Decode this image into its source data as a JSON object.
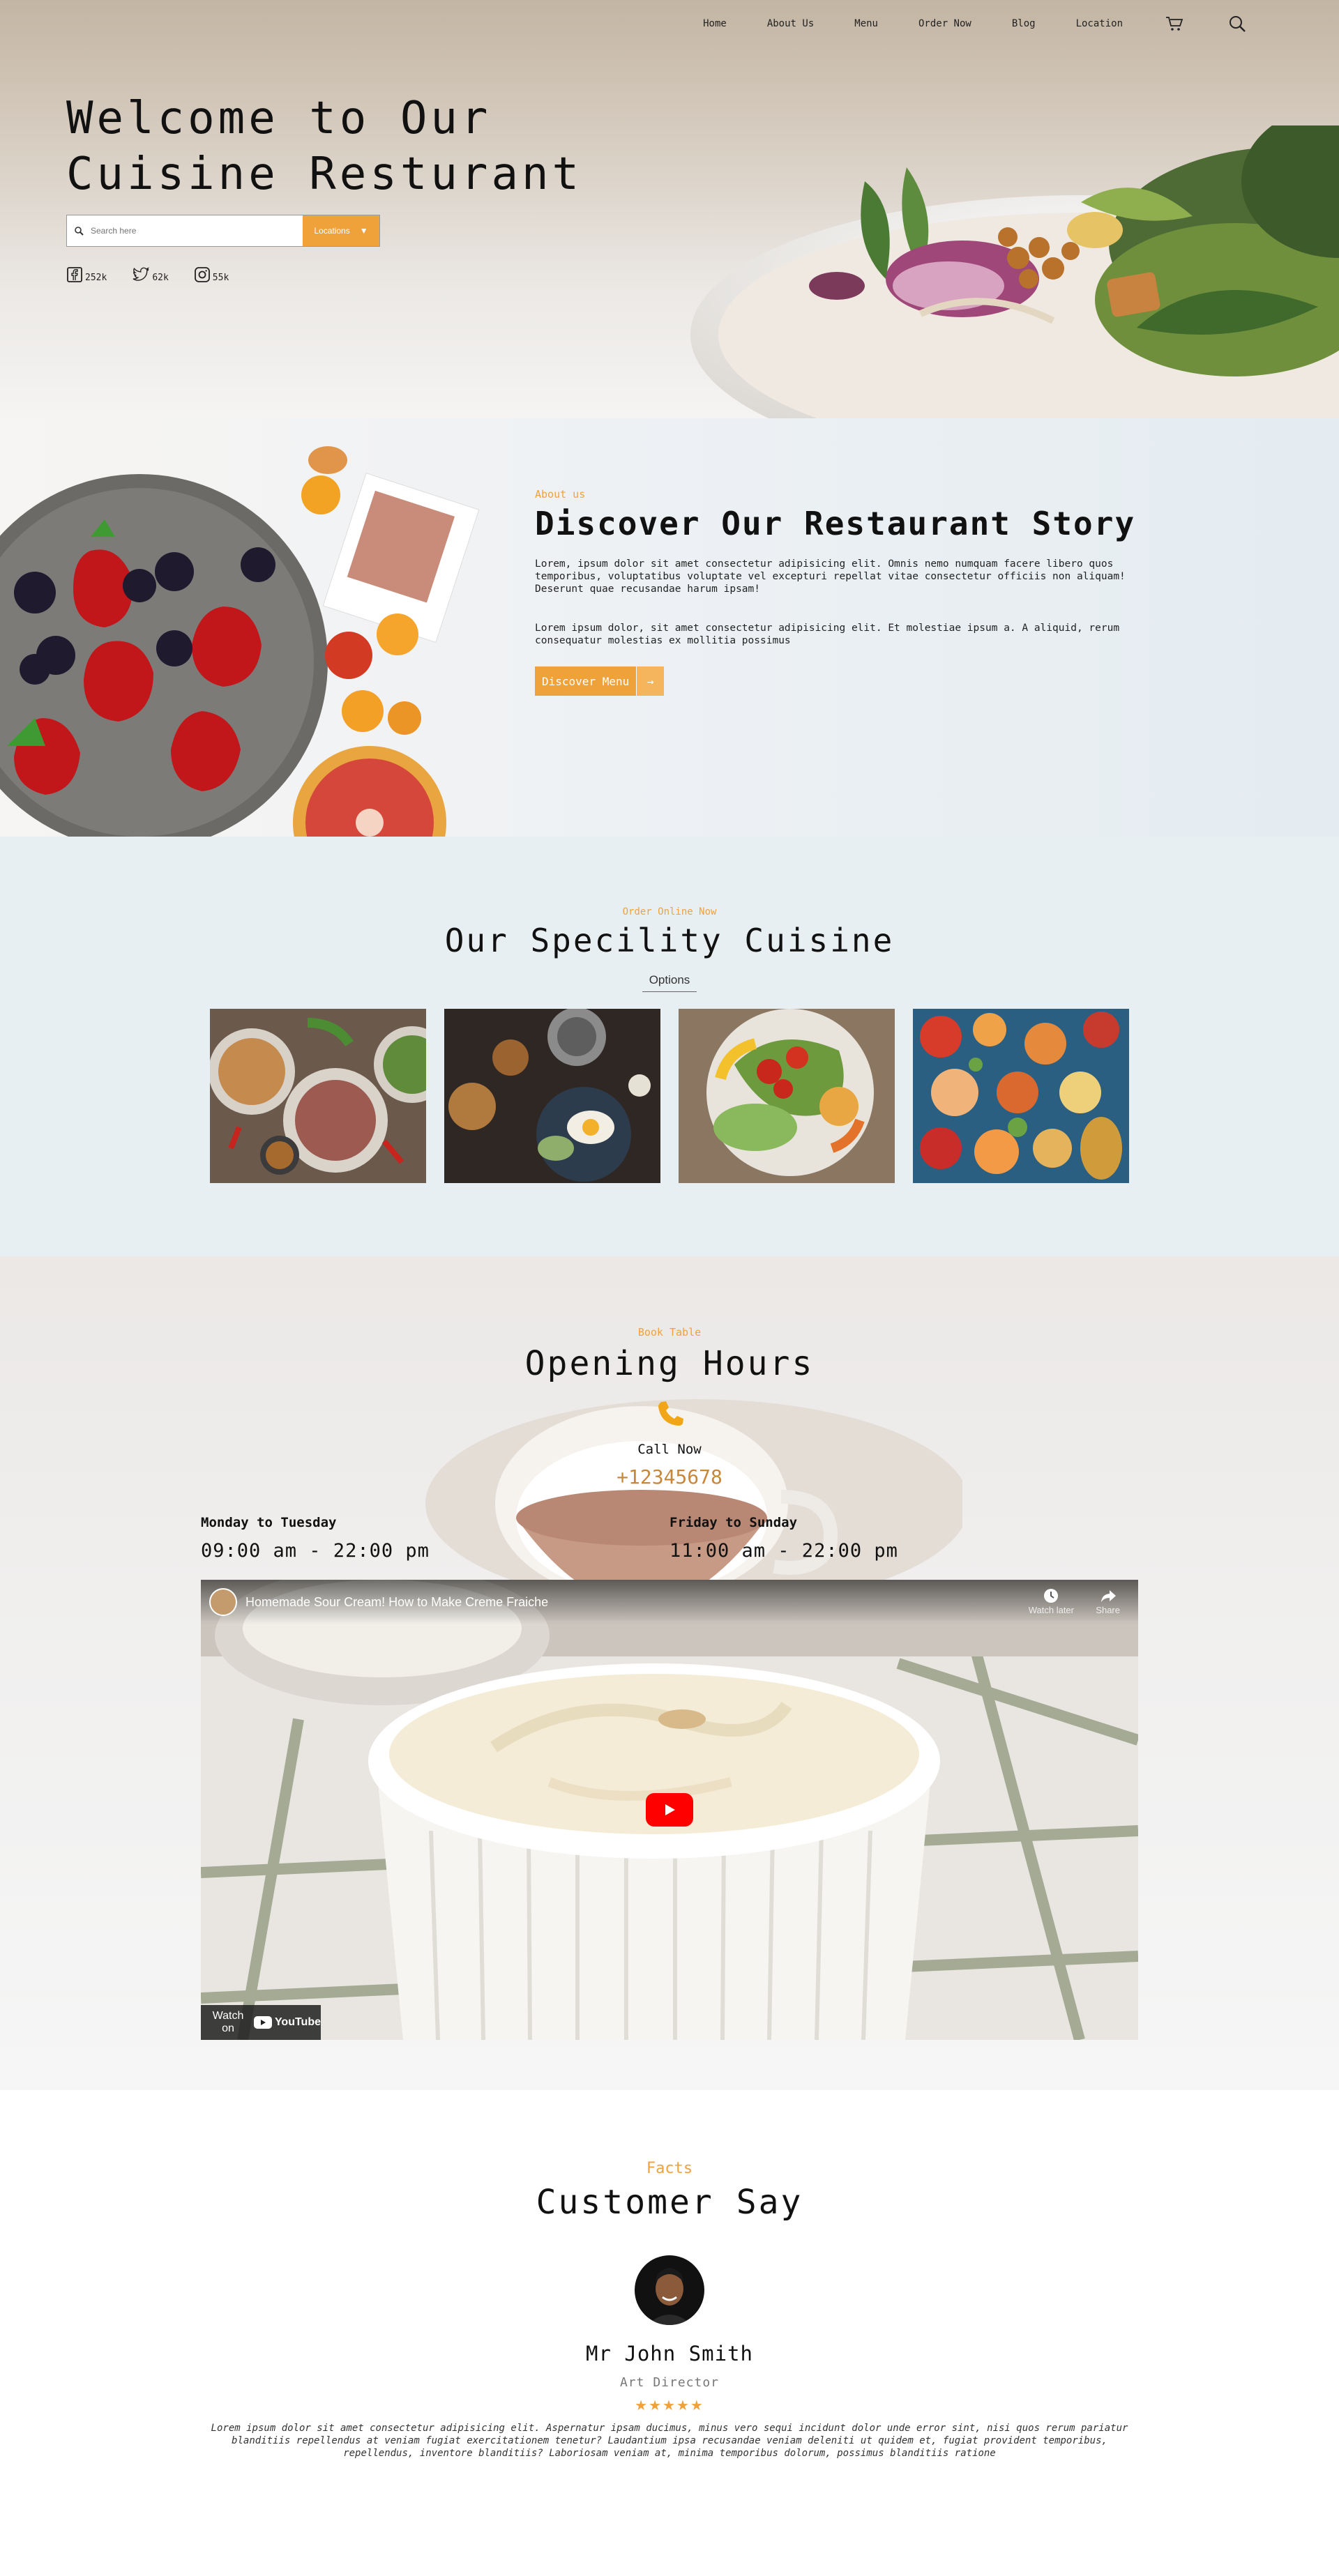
{
  "nav": {
    "items": [
      "Home",
      "About Us",
      "Menu",
      "Order Now",
      "Blog",
      "Location"
    ],
    "icons": [
      "cart-icon",
      "search-icon"
    ]
  },
  "hero": {
    "title_line1": "Welcome to Our",
    "title_line2": "Cuisine Resturant",
    "search_placeholder": "Search here",
    "location_label": "Locations",
    "social": [
      {
        "icon": "facebook-icon",
        "count": "252k"
      },
      {
        "icon": "twitter-icon",
        "count": "62k"
      },
      {
        "icon": "instagram-icon",
        "count": "55k"
      }
    ]
  },
  "about": {
    "eyebrow": "About us",
    "title": "Discover Our Restaurant Story",
    "para1": "Lorem, ipsum dolor sit amet consectetur adipisicing elit. Omnis nemo numquam facere libero quos temporibus, voluptatibus voluptate vel excepturi repellat vitae consectetur officiis non aliquam! Deserunt quae recusandae harum ipsam!",
    "para2": "Lorem ipsum dolor, sit amet consectetur adipisicing elit. Et molestiae ipsum a. A aliquid, rerum consequatur molestias ex mollitia possimus",
    "button_label": "Discover Menu",
    "button_arrow": "→"
  },
  "speciality": {
    "eyebrow": "Order Online Now",
    "title": "Our Specility Cuisine",
    "options_label": "Options"
  },
  "opening": {
    "eyebrow": "Book Table",
    "title": "Opening Hours",
    "call_label": "Call Now",
    "phone": "+12345678",
    "schedule": [
      {
        "days": "Monday to Tuesday",
        "hours": "09:00 am - 22:00 pm"
      },
      {
        "days": "Friday to Sunday",
        "hours": "11:00 am - 22:00 pm"
      }
    ],
    "video": {
      "title": "Homemade Sour Cream! How to Make Creme Fraiche",
      "watch_later": "Watch later",
      "share": "Share",
      "watch_on": "Watch on",
      "youtube": "YouTube"
    }
  },
  "testimonial": {
    "eyebrow": "Facts",
    "title": "Customer Say",
    "name": "Mr John Smith",
    "role": "Art Director",
    "stars": "★★★★★",
    "rating": 5,
    "quote": "Lorem ipsum dolor sit amet consectetur adipisicing elit. Aspernatur ipsam ducimus, minus vero sequi incidunt dolor unde error sint, nisi quos rerum pariatur blanditiis repellendus at veniam fugiat exercitationem tenetur? Laudantium ipsa recusandae veniam deleniti ut quidem et, fugiat provident temporibus, repellendus, inventore blanditiis? Laboriosam veniam at, minima temporibus dolorum, possimus blanditiis ratione"
  },
  "colors": {
    "accent": "#f0a23a",
    "phone": "#c8873b",
    "section_bg": "#e8eff2"
  }
}
